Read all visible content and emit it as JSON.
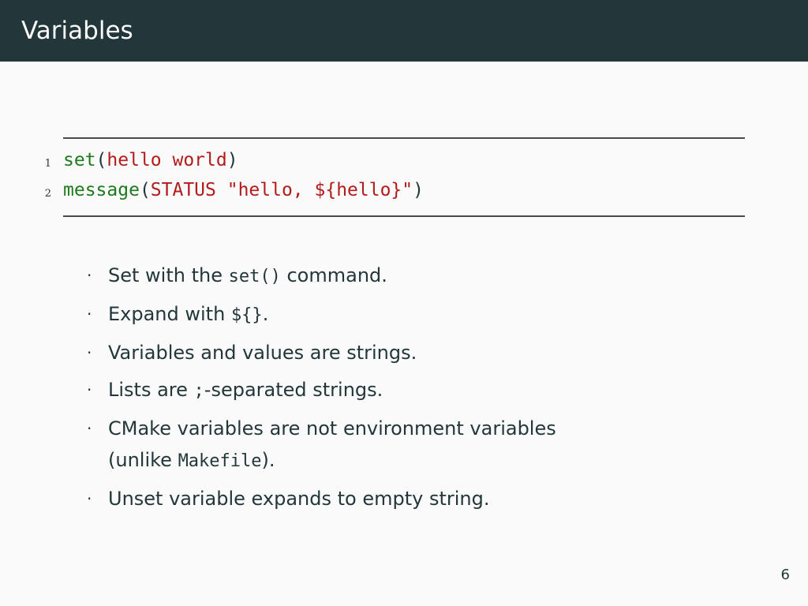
{
  "slide": {
    "title": "Variables",
    "page_number": "6"
  },
  "code": {
    "lines": [
      {
        "number": "1",
        "fn": "set",
        "open": "(",
        "args": "hello world",
        "close": ")"
      },
      {
        "number": "2",
        "fn": "message",
        "open": "(",
        "args": "STATUS \"hello, ${hello}\"",
        "close": ")"
      }
    ]
  },
  "bullets": [
    {
      "before": "Set with the ",
      "code": "set()",
      "after": " command."
    },
    {
      "before": "Expand with ",
      "code": "${}",
      "after": "."
    },
    {
      "before": "Variables and values are strings.",
      "code": "",
      "after": ""
    },
    {
      "before": "Lists are ",
      "code": ";",
      "after": "-separated strings."
    },
    {
      "before": "CMake variables are not environment variables",
      "line2_before": "(unlike ",
      "code": "Makefile",
      "after": ")."
    },
    {
      "before": "Unset variable expands to empty string.",
      "code": "",
      "after": ""
    }
  ],
  "colors": {
    "header_bg": "#23373b",
    "background": "#fafafa",
    "function": "#1d7a1d",
    "argument": "#b31b1b"
  }
}
